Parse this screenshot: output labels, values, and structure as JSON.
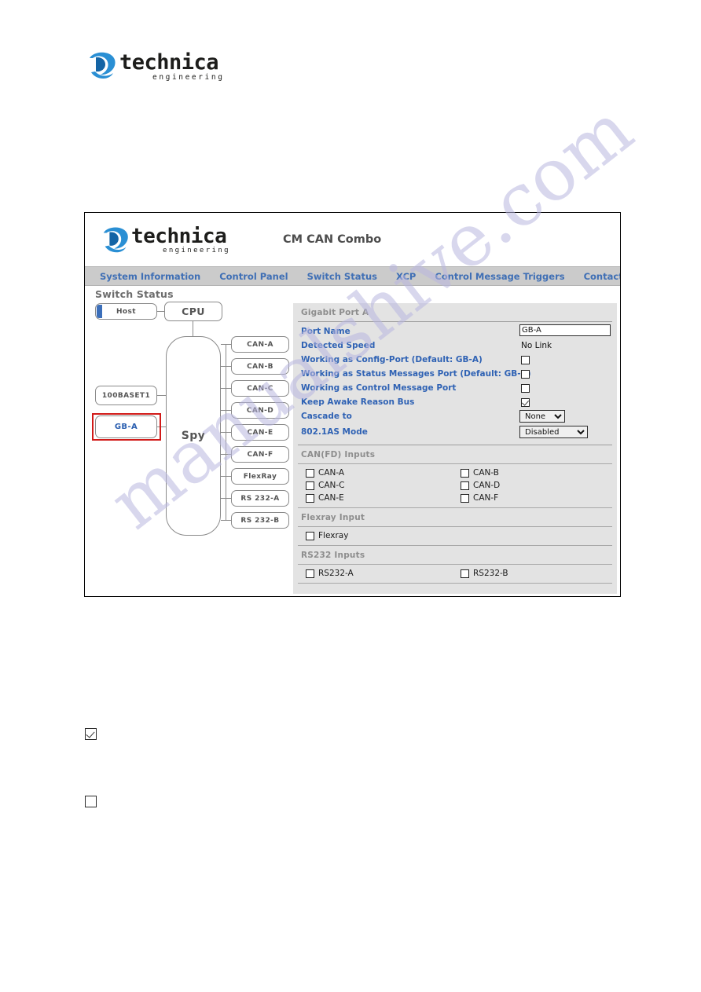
{
  "page_logo": {
    "wordmark": "technica",
    "subtitle": "engineering"
  },
  "app": {
    "logo": {
      "wordmark": "technica",
      "subtitle": "engineering"
    },
    "device_title": "CM CAN Combo",
    "nav": [
      {
        "label": "System Information"
      },
      {
        "label": "Control Panel"
      },
      {
        "label": "Switch Status"
      },
      {
        "label": "XCP"
      },
      {
        "label": "Control Message Triggers"
      },
      {
        "label": "Contact"
      }
    ],
    "section_title": "Switch Status"
  },
  "diagram": {
    "host": "Host",
    "cpu": "CPU",
    "spy": "Spy",
    "base_t1": "100BASET1",
    "gb_a": "GB-A",
    "leaves": [
      {
        "label": "CAN-A"
      },
      {
        "label": "CAN-B"
      },
      {
        "label": "CAN-C"
      },
      {
        "label": "CAN-D"
      },
      {
        "label": "CAN-E"
      },
      {
        "label": "CAN-F"
      },
      {
        "label": "FlexRay"
      },
      {
        "label": "RS 232-A"
      },
      {
        "label": "RS 232-B"
      }
    ]
  },
  "settings": {
    "gigabit": {
      "title": "Gigabit Port A",
      "port_name_label": "Port Name",
      "port_name_value": "GB-A",
      "detected_speed_label": "Detected Speed",
      "detected_speed_value": "No Link",
      "config_port_label": "Working as Config-Port (Default: GB-A)",
      "config_port_checked": false,
      "status_port_label": "Working as Status Messages Port (Default: GB-A)",
      "status_port_checked": false,
      "control_port_label": "Working as Control Message Port",
      "control_port_checked": false,
      "keep_awake_label": "Keep Awake Reason Bus",
      "keep_awake_checked": true,
      "cascade_label": "Cascade to",
      "cascade_value": "None",
      "cascade_options": [
        "None"
      ],
      "mode_label": "802.1AS Mode",
      "mode_value": "Disabled",
      "mode_options": [
        "Disabled"
      ]
    },
    "can_inputs": {
      "title": "CAN(FD) Inputs",
      "items": [
        {
          "label": "CAN-A",
          "checked": false
        },
        {
          "label": "CAN-B",
          "checked": false
        },
        {
          "label": "CAN-C",
          "checked": false
        },
        {
          "label": "CAN-D",
          "checked": false
        },
        {
          "label": "CAN-E",
          "checked": false
        },
        {
          "label": "CAN-F",
          "checked": false
        }
      ]
    },
    "flexray_input": {
      "title": "Flexray Input",
      "items": [
        {
          "label": "Flexray",
          "checked": false
        }
      ]
    },
    "rs232_inputs": {
      "title": "RS232 Inputs",
      "items": [
        {
          "label": "RS232-A",
          "checked": false
        },
        {
          "label": "RS232-B",
          "checked": false
        }
      ]
    }
  },
  "standalone_checkboxes": [
    {
      "checked": true
    },
    {
      "checked": false
    }
  ],
  "watermark": {
    "text": "manualshive.com"
  },
  "colors": {
    "nav_link": "#3f6fb5",
    "form_label": "#2f62b4",
    "logo_blue": "#2a8fd4",
    "highlight_red": "#d11a18",
    "panel_bg": "#e3e3e3",
    "nav_bg": "#cbcbcb",
    "watermark": "#b9b7e0"
  }
}
